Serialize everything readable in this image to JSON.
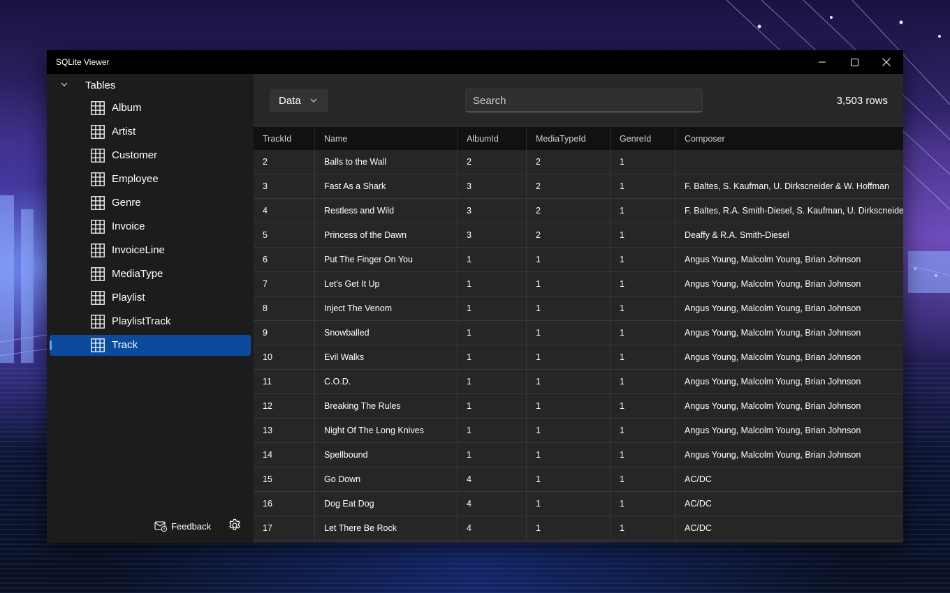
{
  "window": {
    "title": "SQLite Viewer"
  },
  "sidebar": {
    "root_label": "Tables",
    "items": [
      {
        "label": "Album",
        "icon": "table-icon"
      },
      {
        "label": "Artist",
        "icon": "table-icon"
      },
      {
        "label": "Customer",
        "icon": "table-icon"
      },
      {
        "label": "Employee",
        "icon": "table-icon"
      },
      {
        "label": "Genre",
        "icon": "table-icon"
      },
      {
        "label": "Invoice",
        "icon": "table-icon"
      },
      {
        "label": "InvoiceLine",
        "icon": "table-icon"
      },
      {
        "label": "MediaType",
        "icon": "table-icon"
      },
      {
        "label": "Playlist",
        "icon": "table-icon"
      },
      {
        "label": "PlaylistTrack",
        "icon": "table-icon"
      },
      {
        "label": "Track",
        "icon": "table-icon",
        "selected": true
      }
    ],
    "feedback_label": "Feedback"
  },
  "toolbar": {
    "view_selected": "Data",
    "search_placeholder": "Search",
    "row_count": "3,503 rows"
  },
  "table": {
    "columns": [
      "TrackId",
      "Name",
      "AlbumId",
      "MediaTypeId",
      "GenreId",
      "Composer"
    ],
    "rows": [
      [
        "2",
        "Balls to the Wall",
        "2",
        "2",
        "1",
        ""
      ],
      [
        "3",
        "Fast As a Shark",
        "3",
        "2",
        "1",
        "F. Baltes, S. Kaufman, U. Dirkscneider & W. Hoffman"
      ],
      [
        "4",
        "Restless and Wild",
        "3",
        "2",
        "1",
        "F. Baltes, R.A. Smith-Diesel, S. Kaufman, U. Dirkscneider"
      ],
      [
        "5",
        "Princess of the Dawn",
        "3",
        "2",
        "1",
        "Deaffy & R.A. Smith-Diesel"
      ],
      [
        "6",
        "Put The Finger On You",
        "1",
        "1",
        "1",
        "Angus Young, Malcolm Young, Brian Johnson"
      ],
      [
        "7",
        "Let's Get It Up",
        "1",
        "1",
        "1",
        "Angus Young, Malcolm Young, Brian Johnson"
      ],
      [
        "8",
        "Inject The Venom",
        "1",
        "1",
        "1",
        "Angus Young, Malcolm Young, Brian Johnson"
      ],
      [
        "9",
        "Snowballed",
        "1",
        "1",
        "1",
        "Angus Young, Malcolm Young, Brian Johnson"
      ],
      [
        "10",
        "Evil Walks",
        "1",
        "1",
        "1",
        "Angus Young, Malcolm Young, Brian Johnson"
      ],
      [
        "11",
        "C.O.D.",
        "1",
        "1",
        "1",
        "Angus Young, Malcolm Young, Brian Johnson"
      ],
      [
        "12",
        "Breaking The Rules",
        "1",
        "1",
        "1",
        "Angus Young, Malcolm Young, Brian Johnson"
      ],
      [
        "13",
        "Night Of The Long Knives",
        "1",
        "1",
        "1",
        "Angus Young, Malcolm Young, Brian Johnson"
      ],
      [
        "14",
        "Spellbound",
        "1",
        "1",
        "1",
        "Angus Young, Malcolm Young, Brian Johnson"
      ],
      [
        "15",
        "Go Down",
        "4",
        "1",
        "1",
        "AC/DC"
      ],
      [
        "16",
        "Dog Eat Dog",
        "4",
        "1",
        "1",
        "AC/DC"
      ],
      [
        "17",
        "Let There Be Rock",
        "4",
        "1",
        "1",
        "AC/DC"
      ]
    ]
  },
  "colors": {
    "accent": "#0b4a9c",
    "selection_indicator": "#5aa7f2",
    "window_bg": "#202020",
    "titlebar_bg": "#000000"
  }
}
